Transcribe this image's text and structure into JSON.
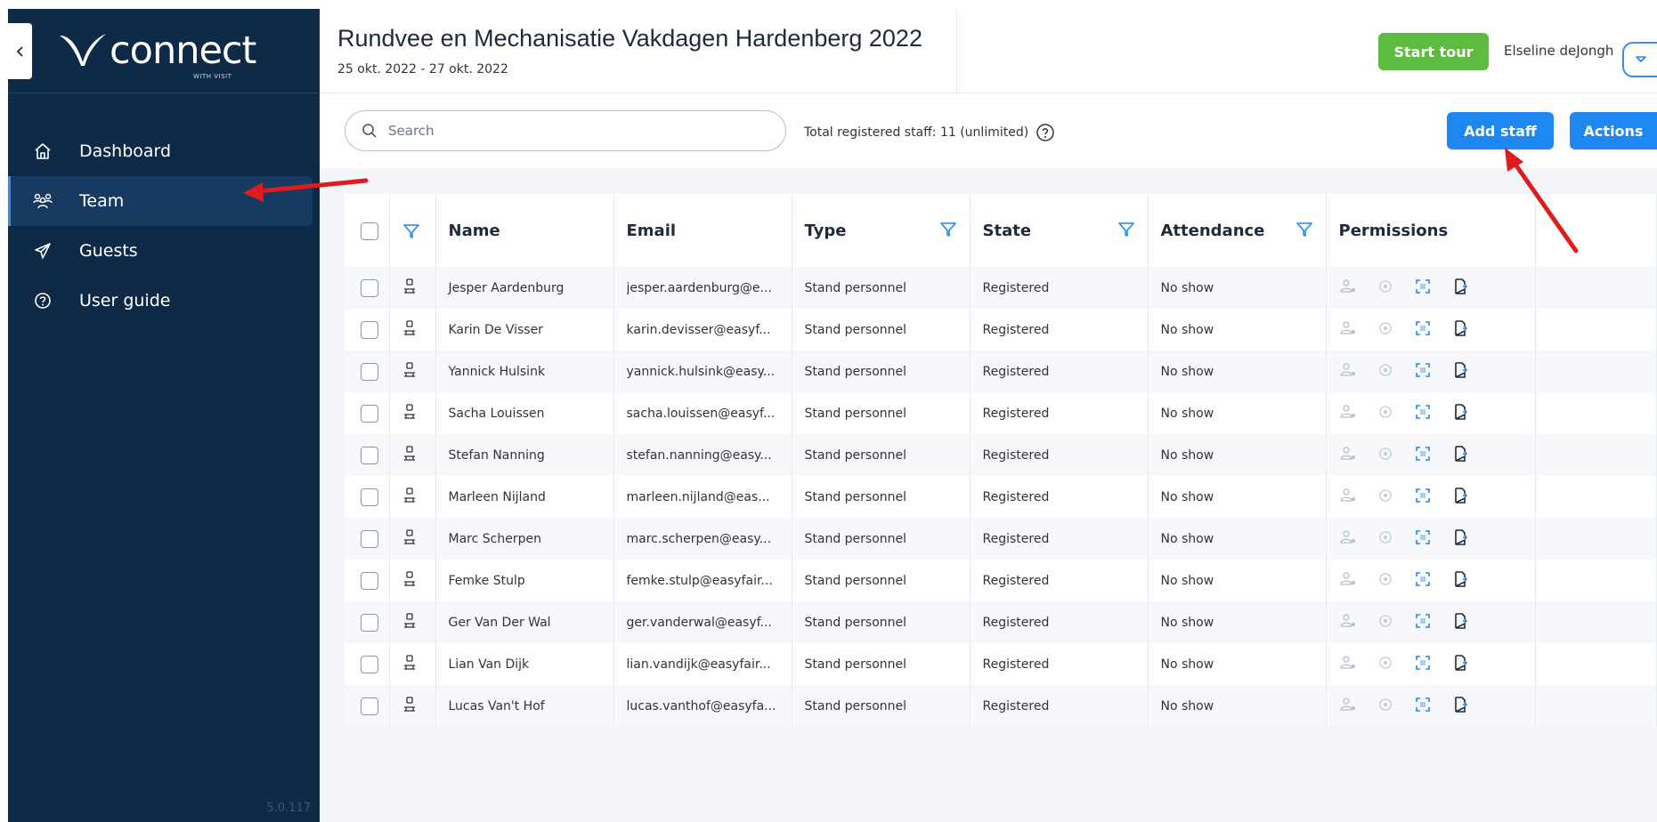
{
  "app": {
    "logo_text": "connect",
    "logo_subtext": "WITH VISIT",
    "version": "5.0.117"
  },
  "sidebar": {
    "items": [
      {
        "label": "Dashboard",
        "icon": "home-icon",
        "active": false
      },
      {
        "label": "Team",
        "icon": "team-icon",
        "active": true
      },
      {
        "label": "Guests",
        "icon": "send-icon",
        "active": false
      },
      {
        "label": "User guide",
        "icon": "help-icon",
        "active": false
      }
    ]
  },
  "header": {
    "event_title": "Rundvee en Mechanisatie Vakdagen Hardenberg 2022",
    "event_dates": "25 okt. 2022 - 27 okt. 2022",
    "start_tour_label": "Start tour",
    "user_name": "Elseline deJongh"
  },
  "toolbar": {
    "search_placeholder": "Search",
    "total_staff": "Total registered staff: 11 (unlimited)",
    "add_staff_label": "Add staff",
    "actions_label": "Actions"
  },
  "table": {
    "columns": {
      "name": "Name",
      "email": "Email",
      "type": "Type",
      "state": "State",
      "attendance": "Attendance",
      "permissions": "Permissions"
    },
    "rows": [
      {
        "name": "Jesper Aardenburg",
        "email": "jesper.aardenburg@e...",
        "type": "Stand personnel",
        "state": "Registered",
        "attendance": "No show"
      },
      {
        "name": "Karin De Visser",
        "email": "karin.devisser@easyf...",
        "type": "Stand personnel",
        "state": "Registered",
        "attendance": "No show"
      },
      {
        "name": "Yannick Hulsink",
        "email": "yannick.hulsink@easy...",
        "type": "Stand personnel",
        "state": "Registered",
        "attendance": "No show"
      },
      {
        "name": "Sacha Louissen",
        "email": "sacha.louissen@easyf...",
        "type": "Stand personnel",
        "state": "Registered",
        "attendance": "No show"
      },
      {
        "name": "Stefan Nanning",
        "email": "stefan.nanning@easy...",
        "type": "Stand personnel",
        "state": "Registered",
        "attendance": "No show"
      },
      {
        "name": "Marleen Nijland",
        "email": "marleen.nijland@eas...",
        "type": "Stand personnel",
        "state": "Registered",
        "attendance": "No show"
      },
      {
        "name": "Marc Scherpen",
        "email": "marc.scherpen@easy...",
        "type": "Stand personnel",
        "state": "Registered",
        "attendance": "No show"
      },
      {
        "name": "Femke Stulp",
        "email": "femke.stulp@easyfair...",
        "type": "Stand personnel",
        "state": "Registered",
        "attendance": "No show"
      },
      {
        "name": "Ger Van Der Wal",
        "email": "ger.vanderwal@easyf...",
        "type": "Stand personnel",
        "state": "Registered",
        "attendance": "No show"
      },
      {
        "name": "Lian Van Dijk",
        "email": "lian.vandijk@easyfair...",
        "type": "Stand personnel",
        "state": "Registered",
        "attendance": "No show"
      },
      {
        "name": "Lucas Van't Hof",
        "email": "lucas.vanthof@easyfa...",
        "type": "Stand personnel",
        "state": "Registered",
        "attendance": "No show"
      }
    ]
  },
  "colors": {
    "sidebar_bg": "#0e2a47",
    "primary": "#1e88f0",
    "start_tour": "#5dbb3f",
    "annotation_arrow": "#e01b1b"
  }
}
